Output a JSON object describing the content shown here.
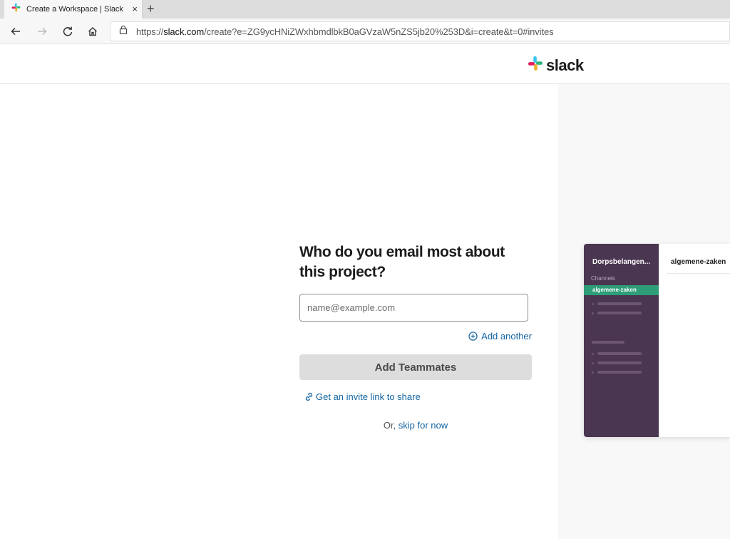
{
  "browser": {
    "tab_title": "Create a Workspace | Slack",
    "tab_close": "×",
    "new_tab": "+",
    "url_scheme": "https://",
    "url_host": "slack.com",
    "url_rest": "/create?e=ZG9ycHNiZWxhbmdlbkB0aGVzaW5nZS5jb20%253D&i=create&t=0#invites"
  },
  "header": {
    "logo_text": "slack"
  },
  "main": {
    "headline": "Who do you email most about this project?",
    "email_placeholder": "name@example.com",
    "add_another": "Add another",
    "add_button": "Add Teammates",
    "invite_link": "Get an invite link to share",
    "skip_prefix": "Or, ",
    "skip_link": "skip for now"
  },
  "preview": {
    "workspace_name": "Dorpsbelangen...",
    "channels_label": "Channels",
    "active_channel": "algemene-zaken",
    "main_channel_title": "algemene-zaken"
  },
  "colors": {
    "link": "#1264a3",
    "sidebar": "#4a3650",
    "active_channel": "#2d9e78",
    "button_disabled": "#dddddd"
  }
}
